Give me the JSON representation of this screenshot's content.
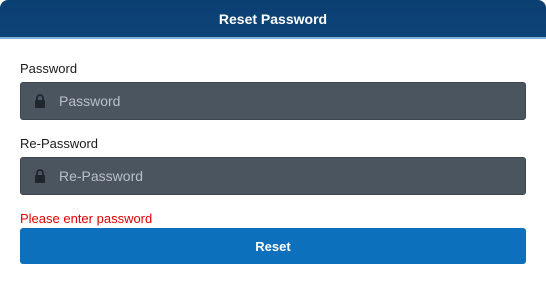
{
  "dialog": {
    "title": "Reset Password"
  },
  "password": {
    "label": "Password",
    "placeholder": "Password",
    "value": "",
    "icon": "lock-icon"
  },
  "repassword": {
    "label": "Re-Password",
    "placeholder": "Re-Password",
    "value": "",
    "icon": "lock-icon"
  },
  "error": {
    "message": "Please enter password"
  },
  "actions": {
    "reset_label": "Reset"
  },
  "colors": {
    "header": "#0d4478",
    "input_bg": "#4a5560",
    "button": "#0d70bd",
    "error": "#e00000"
  }
}
